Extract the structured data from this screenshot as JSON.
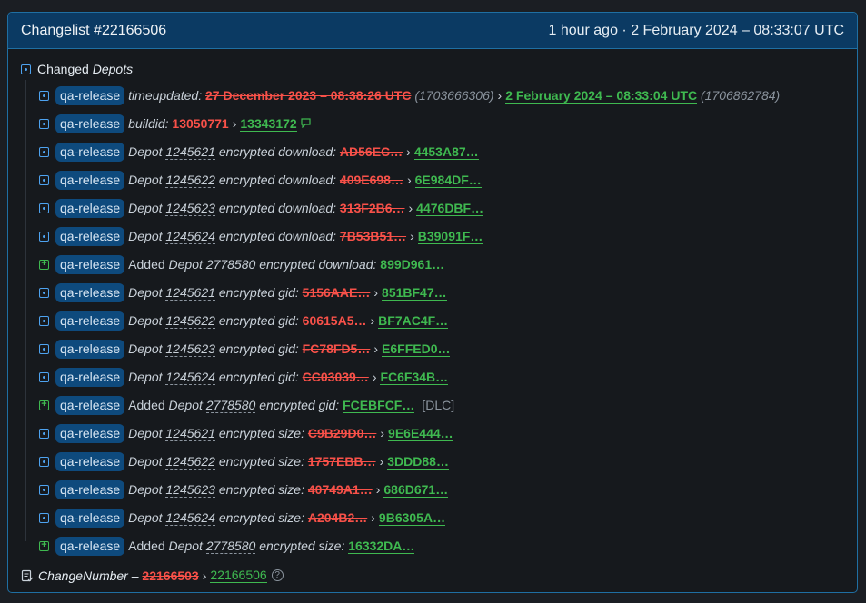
{
  "header": {
    "title": "Changelist #22166506",
    "time": "1 hour ago · 2 February 2024 – 08:33:07 UTC"
  },
  "section": {
    "label": "Changed",
    "italic": "Depots"
  },
  "badge": "qa-release",
  "rows": {
    "r0": {
      "key": "timeupdated:",
      "old": "27 December 2023 – 08:38:26 UTC",
      "old_ts": "(1703666306)",
      "new": "2 February 2024 – 08:33:04 UTC",
      "new_ts": "(1706862784)"
    },
    "r1": {
      "key": "buildid:",
      "old": "13050771",
      "new": "13343172",
      "icon": "patch-notes-icon"
    },
    "r2": {
      "prefix": "Depot",
      "depot": "1245621",
      "key": "encrypted download:",
      "old": "AD56EC…",
      "new": "4453A87…"
    },
    "r3": {
      "prefix": "Depot",
      "depot": "1245622",
      "key": "encrypted download:",
      "old": "409E698…",
      "new": "6E984DF…"
    },
    "r4": {
      "prefix": "Depot",
      "depot": "1245623",
      "key": "encrypted download:",
      "old": "313F2B6…",
      "new": "4476DBF…"
    },
    "r5": {
      "prefix": "Depot",
      "depot": "1245624",
      "key": "encrypted download:",
      "old": "7B53B51…",
      "new": "B39091F…"
    },
    "r6": {
      "added": "Added",
      "prefix": "Depot",
      "depot": "2778580",
      "key": "encrypted download:",
      "new": "899D961…"
    },
    "r7": {
      "prefix": "Depot",
      "depot": "1245621",
      "key": "encrypted gid:",
      "old": "5156AAE…",
      "new": "851BF47…"
    },
    "r8": {
      "prefix": "Depot",
      "depot": "1245622",
      "key": "encrypted gid:",
      "old": "60615A5…",
      "new": "BF7AC4F…"
    },
    "r9": {
      "prefix": "Depot",
      "depot": "1245623",
      "key": "encrypted gid:",
      "old": "FC78FD5…",
      "new": "E6FFED0…"
    },
    "r10": {
      "prefix": "Depot",
      "depot": "1245624",
      "key": "encrypted gid:",
      "old": "CC03039…",
      "new": "FC6F34B…"
    },
    "r11": {
      "added": "Added",
      "prefix": "Depot",
      "depot": "2778580",
      "key": "encrypted gid:",
      "new": "FCEBFCF…",
      "tag": "[DLC]"
    },
    "r12": {
      "prefix": "Depot",
      "depot": "1245621",
      "key": "encrypted size:",
      "old": "C9B29D0…",
      "new": "9E6E444…"
    },
    "r13": {
      "prefix": "Depot",
      "depot": "1245622",
      "key": "encrypted size:",
      "old": "1757EBB…",
      "new": "3DDD88…"
    },
    "r14": {
      "prefix": "Depot",
      "depot": "1245623",
      "key": "encrypted size:",
      "old": "40749A1…",
      "new": "686D671…"
    },
    "r15": {
      "prefix": "Depot",
      "depot": "1245624",
      "key": "encrypted size:",
      "old": "A204B2…",
      "new": "9B6305A…"
    },
    "r16": {
      "added": "Added",
      "prefix": "Depot",
      "depot": "2778580",
      "key": "encrypted size:",
      "new": "16332DA…"
    }
  },
  "footer": {
    "key": "ChangeNumber",
    "dash": "–",
    "old": "22166503",
    "new": "22166506"
  },
  "arrow": "›"
}
